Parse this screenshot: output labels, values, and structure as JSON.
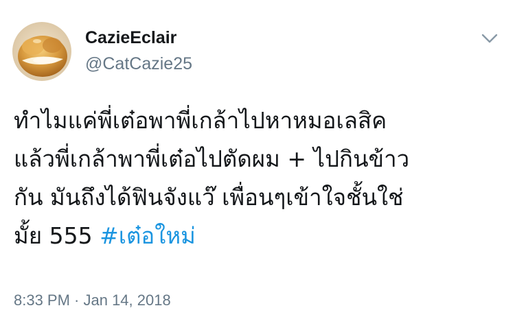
{
  "tweet": {
    "author": {
      "display_name": "CazieEclair",
      "handle": "@CatCazie25",
      "avatar_icon": "cream-puff-avatar"
    },
    "menu_icon": "chevron-down-icon",
    "body_lines": [
      "ทำไมแค่พี่เต๋อพาพี่เกล้าไปหาหมอเลสิค",
      "แล้วพี่เกล้าพาพี่เต๋อไปตัดผม + ไปกินข้าว",
      "กัน มันถึงได้ฟินจังแว๊ เพื่อนๆเข้าใจชั้นใช่"
    ],
    "body_last_line_prefix": "มั้ย 555 ",
    "hashtag": "#เต๋อใหม่",
    "timestamp": "8:33 PM · Jan 14, 2018",
    "colors": {
      "text": "#14171a",
      "secondary": "#657786",
      "link": "#1b95e0"
    }
  }
}
